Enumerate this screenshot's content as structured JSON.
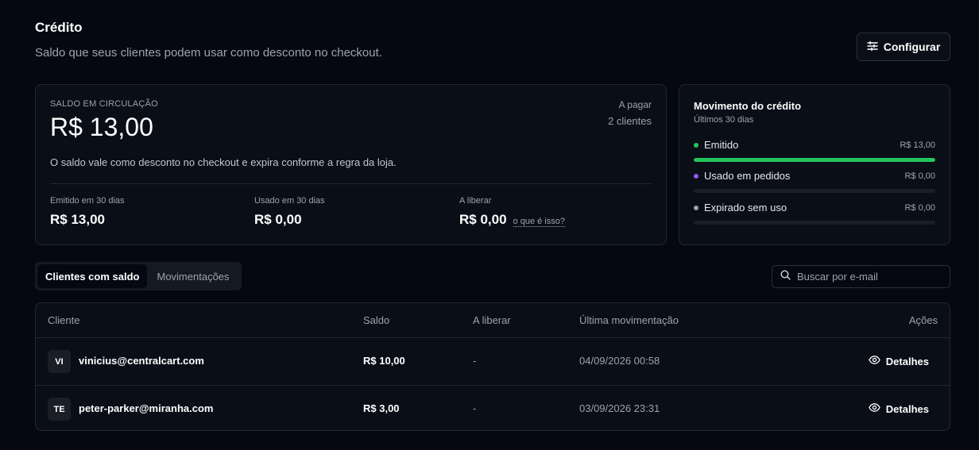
{
  "header": {
    "title": "Crédito",
    "subtitle": "Saldo que seus clientes podem usar como desconto no checkout.",
    "configure_label": "Configurar"
  },
  "balance": {
    "label": "SALDO EM CIRCULAÇÃO",
    "amount": "R$ 13,00",
    "to_pay_label": "A pagar",
    "clients": "2 clientes",
    "note": "O saldo vale como desconto no checkout e expira conforme a regra da loja.",
    "stats": [
      {
        "label": "Emitido em 30 dias",
        "value": "R$ 13,00"
      },
      {
        "label": "Usado em 30 dias",
        "value": "R$ 0,00"
      },
      {
        "label": "A liberar",
        "value": "R$ 0,00",
        "link": "o que é isso?"
      }
    ]
  },
  "movement": {
    "title": "Movimento do crédito",
    "subtitle": "Últimos 30 dias",
    "rows": [
      {
        "name": "Emitido",
        "value": "R$ 13,00",
        "color": "#22c55e",
        "fill": 1.0
      },
      {
        "name": "Usado em pedidos",
        "value": "R$ 0,00",
        "color": "#8b5cf6",
        "fill": 0.0
      },
      {
        "name": "Expirado sem uso",
        "value": "R$ 0,00",
        "color": "#9ca3af",
        "fill": 0.0
      }
    ]
  },
  "tabs": [
    {
      "label": "Clientes com saldo",
      "active": true
    },
    {
      "label": "Movimentações",
      "active": false
    }
  ],
  "search": {
    "placeholder": "Buscar por e-mail"
  },
  "table": {
    "columns": [
      "Cliente",
      "Saldo",
      "A liberar",
      "Última movimentação",
      "Ações"
    ],
    "rows": [
      {
        "initials": "VI",
        "email": "vinicius@centralcart.com",
        "saldo": "R$ 10,00",
        "liberar": "-",
        "last": "04/09/2026 00:58",
        "action": "Detalhes"
      },
      {
        "initials": "TE",
        "email": "peter-parker@miranha.com",
        "saldo": "R$ 3,00",
        "liberar": "-",
        "last": "03/09/2026 23:31",
        "action": "Detalhes"
      }
    ]
  },
  "colors": {
    "accent_green": "#22c55e",
    "accent_purple": "#8b5cf6",
    "muted": "#9ca3af"
  },
  "icons": {
    "configure": "sliders-icon",
    "search": "search-icon",
    "details": "eye-icon"
  }
}
